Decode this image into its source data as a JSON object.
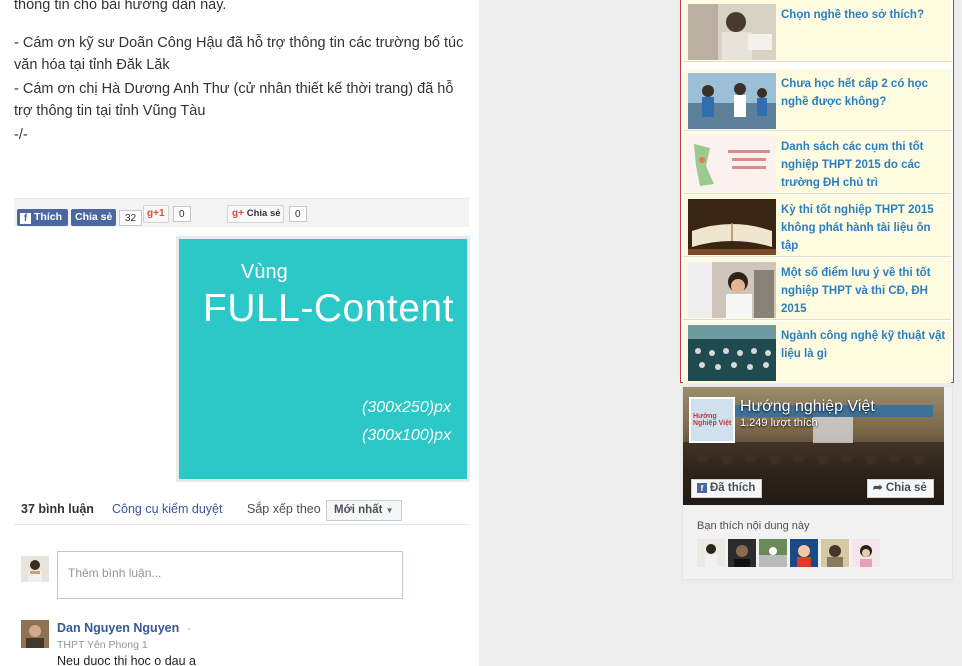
{
  "article": {
    "line0": "thông tin cho bài hướng dẫn này.",
    "line1": "- Cám ơn kỹ sư Doãn Công Hậu đã hỗ trợ thông tin các trường bổ túc văn hóa tại tỉnh Đăk Lăk",
    "line2": "- Cám ơn chị Hà Dương Anh Thư (cử nhân thiết kế thời trang) đã hỗ trợ thông tin tại tỉnh Vũng Tàu",
    "line3": "-/-"
  },
  "social": {
    "like_label": "Thích",
    "share_label": "Chia sẻ",
    "share_count": "32",
    "gplus_label": "+1",
    "gplus_count": "0",
    "gshare_label": "Chia sẻ",
    "gshare_count": "0"
  },
  "ad": {
    "line1": "Vùng",
    "line2": "FULL-Content",
    "size1": "(300x250)px",
    "size2": "(300x100)px"
  },
  "comments": {
    "count_label": "37 bình luận",
    "tools_label": "Công cụ kiểm duyệt",
    "sort_label": "Sắp xếp theo",
    "sort_value": "Mới nhất",
    "input_placeholder": "Thêm bình luận...",
    "items": [
      {
        "name": "Dan Nguyen Nguyen",
        "dot": "·",
        "subtitle": "THPT Yên Phong 1",
        "text": "Neu duoc thi hoc o dau a"
      }
    ]
  },
  "sidebar": {
    "items": [
      {
        "title": "Chọn nghề theo sở thích?"
      },
      {
        "title": "Chưa học hết cấp 2 có học nghề được không?"
      },
      {
        "title": "Danh sách các cụm thi tốt nghiệp THPT 2015 do các trường ĐH chủ trì"
      },
      {
        "title": "Kỳ thi tốt nghiệp THPT 2015 không phát hành tài liệu ôn tập"
      },
      {
        "title": "Một số điểm lưu ý về thi tốt nghiệp THPT và thi CĐ, ĐH 2015"
      },
      {
        "title": "Ngành công nghệ kỹ thuật vật liệu là gì"
      }
    ]
  },
  "fb_widget": {
    "page_name": "Hướng nghiệp Việt",
    "likes": "1.249 lượt thích",
    "liked_label": "Đã thích",
    "share_label": "Chia sẻ",
    "friends_label": "Bạn thích nội dung này",
    "logo_text": "Hướng Nghiệp Việt"
  },
  "colors": {
    "fb_blue": "#4b67a1",
    "ad_teal": "#2cc7c7",
    "link_blue": "#2a7fc1",
    "sidebar_border": "#c73a3a",
    "sidebar_bg": "#fefbe1"
  }
}
